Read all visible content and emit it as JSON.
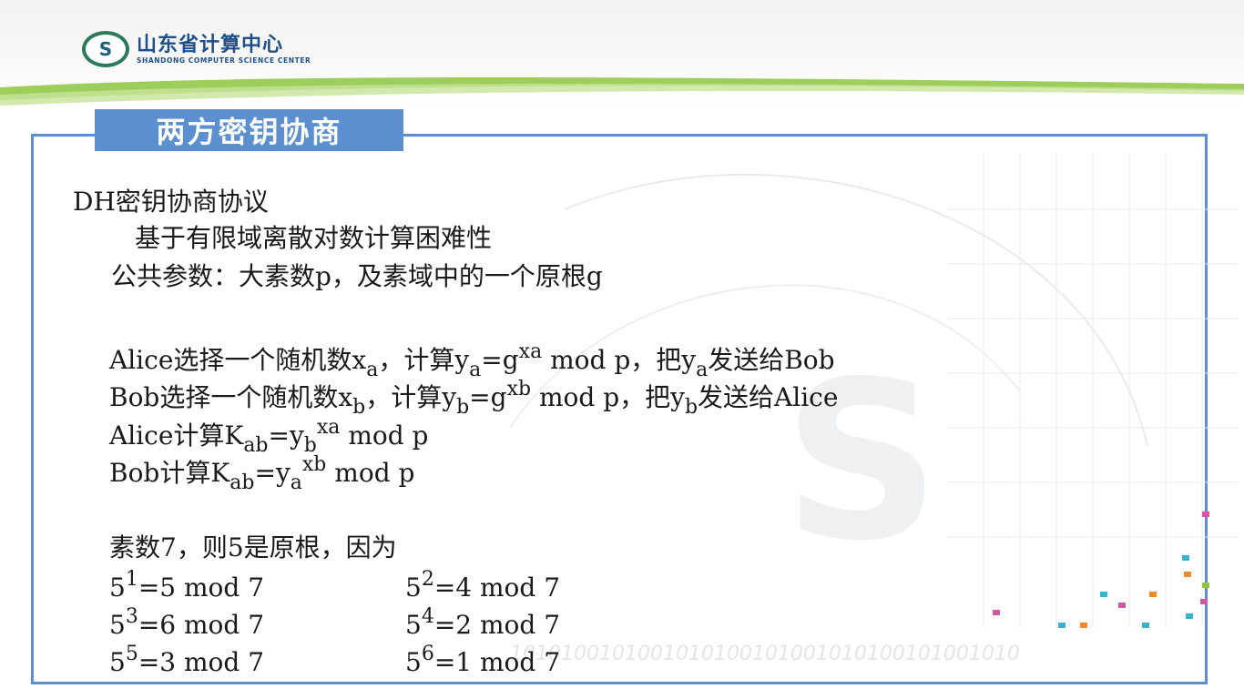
{
  "header": {
    "logo_cn": "山东省计算中心",
    "logo_en": "SHANDONG COMPUTER SCIENCE CENTER",
    "emblem_letter": "S"
  },
  "slide": {
    "title": "两方密钥协商",
    "protocol_name": "DH密钥协商协议",
    "basis": "基于有限域离散对数计算困难性",
    "public_params": "公共参数：大素数p，及素域中的一个原根g",
    "alice_step": {
      "a": "Alice选择一个随机数x",
      "b": "a",
      "c": "，计算y",
      "d": "a",
      "e": "=g",
      "f": "xa",
      "g": " mod p，把y",
      "h": "a",
      "i": "发送给Bob"
    },
    "bob_step": {
      "a": "Bob选择一个随机数x",
      "b": "b",
      "c": "，计算y",
      "d": "b",
      "e": "=g",
      "f": "xb",
      "g": " mod p，把y",
      "h": "b",
      "i": "发送给Alice"
    },
    "alice_key": {
      "a": "Alice计算K",
      "b": "ab",
      "c": "=y",
      "d": "b",
      "e": "xa",
      "f": " mod p"
    },
    "bob_key": {
      "a": "Bob计算K",
      "b": "ab",
      "c": "=y",
      "d": "a",
      "e": "xb",
      "f": " mod p"
    },
    "example_intro": "素数7，则5是原根，因为",
    "powers": [
      {
        "base": "5",
        "exp": "1",
        "rest": "=5 mod 7"
      },
      {
        "base": "5",
        "exp": "2",
        "rest": "=4 mod 7"
      },
      {
        "base": "5",
        "exp": "3",
        "rest": "=6 mod 7"
      },
      {
        "base": "5",
        "exp": "4",
        "rest": "=2 mod 7"
      },
      {
        "base": "5",
        "exp": "5",
        "rest": "=3 mod 7"
      },
      {
        "base": "5",
        "exp": "6",
        "rest": "=1 mod 7"
      }
    ]
  },
  "colors": {
    "accent_blue": "#5b8fd0",
    "logo_blue": "#1f4f8b",
    "swoosh_green": "#8cc63f"
  }
}
